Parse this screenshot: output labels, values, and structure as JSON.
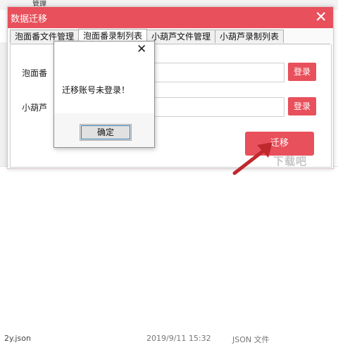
{
  "background": {
    "top_item": "管理",
    "file_name": "2y.json",
    "file_date": "2019/9/11 15:32",
    "file_type": "JSON 文件"
  },
  "dialog": {
    "title": "数据迁移",
    "close_symbol": "✕",
    "tabs": [
      "泡面番文件管理",
      "泡面番录制列表",
      "小葫芦文件管理",
      "小葫芦录制列表"
    ],
    "active_tab": 1,
    "rows": [
      {
        "label": "泡面番",
        "value": "",
        "login_label": "登录"
      },
      {
        "label": "小葫芦",
        "value": "",
        "login_label": "登录"
      }
    ],
    "migrate_label": "迁移"
  },
  "messagebox": {
    "close_symbol": "✕",
    "message": "迁移账号未登录！",
    "ok_label": "确定"
  },
  "watermark": "下载吧",
  "colors": {
    "accent": "#e8505b"
  }
}
